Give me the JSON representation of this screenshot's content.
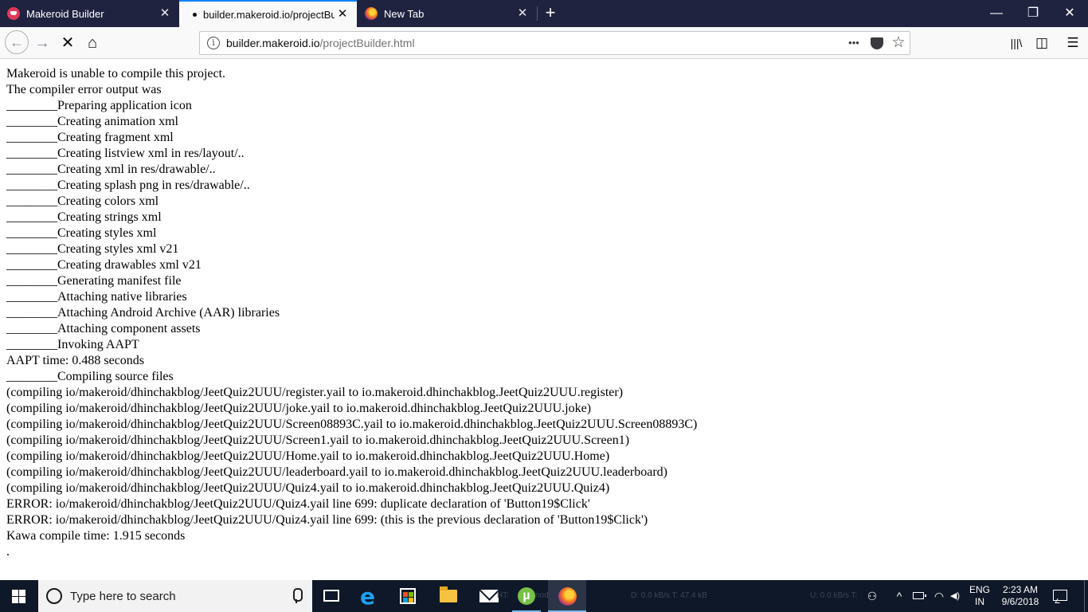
{
  "browser": {
    "tabs": [
      {
        "title": "Makeroid Builder",
        "favicon": "makeroid-icon",
        "active": false
      },
      {
        "title": "builder.makeroid.io/projectBuilder.html",
        "favicon": "loading-dot",
        "active": true
      },
      {
        "title": "New Tab",
        "favicon": "firefox-icon",
        "active": false
      }
    ],
    "close_glyph": "✕",
    "new_tab_glyph": "+",
    "window_controls": {
      "minimize": "—",
      "restore": "❐",
      "close": "✕"
    },
    "nav": {
      "back": "←",
      "forward": "→",
      "stop": "✕",
      "home": "⌂"
    },
    "url": {
      "host": "builder.makeroid.io",
      "path": "/projectBuilder.html"
    },
    "url_actions": {
      "more": "•••",
      "bookmark": "☆"
    },
    "toolbar_right": {
      "library": "|||\\",
      "sidebar": "◫",
      "menu": "☰"
    }
  },
  "page": {
    "lines": [
      "Makeroid is unable to compile this project.",
      "The compiler error output was",
      "________Preparing application icon",
      "________Creating animation xml",
      "________Creating fragment xml",
      "________Creating listview xml in res/layout/..",
      "________Creating xml in res/drawable/..",
      "________Creating splash png in res/drawable/..",
      "________Creating colors xml",
      "________Creating strings xml",
      "________Creating styles xml",
      "________Creating styles xml v21",
      "________Creating drawables xml v21",
      "________Generating manifest file",
      "________Attaching native libraries",
      "________Attaching Android Archive (AAR) libraries",
      "________Attaching component assets",
      "________Invoking AAPT",
      "AAPT time: 0.488 seconds",
      "________Compiling source files",
      "(compiling io/makeroid/dhinchakblog/JeetQuiz2UUU/register.yail to io.makeroid.dhinchakblog.JeetQuiz2UUU.register)",
      "(compiling io/makeroid/dhinchakblog/JeetQuiz2UUU/joke.yail to io.makeroid.dhinchakblog.JeetQuiz2UUU.joke)",
      "(compiling io/makeroid/dhinchakblog/JeetQuiz2UUU/Screen08893C.yail to io.makeroid.dhinchakblog.JeetQuiz2UUU.Screen08893C)",
      "(compiling io/makeroid/dhinchakblog/JeetQuiz2UUU/Screen1.yail to io.makeroid.dhinchakblog.JeetQuiz2UUU.Screen1)",
      "(compiling io/makeroid/dhinchakblog/JeetQuiz2UUU/Home.yail to io.makeroid.dhinchakblog.JeetQuiz2UUU.Home)",
      "(compiling io/makeroid/dhinchakblog/JeetQuiz2UUU/leaderboard.yail to io.makeroid.dhinchakblog.JeetQuiz2UUU.leaderboard)",
      "(compiling io/makeroid/dhinchakblog/JeetQuiz2UUU/Quiz4.yail to io.makeroid.dhinchakblog.JeetQuiz2UUU.Quiz4)",
      "ERROR: io/makeroid/dhinchakblog/JeetQuiz2UUU/Quiz4.yail line 699: duplicate declaration of 'Button19$Click'",
      "ERROR: io/makeroid/dhinchakblog/JeetQuiz2UUU/Quiz4.yail line 699: (this is the previous declaration of 'Button19$Click')",
      "Kawa compile time: 1.915 seconds",
      "."
    ]
  },
  "taskbar": {
    "search_placeholder": "Type here to search",
    "overlay_fragments": {
      "t_label": "HT:",
      "nodes": "nodes",
      "download": "D: 0.0 kB/s T: 47.4 kB",
      "upload": "U: 0.0 kB/s T:"
    },
    "tray": {
      "people": "⚇",
      "chevron": "^",
      "wifi": "◠",
      "volume": "◀)"
    },
    "language": {
      "code": "ENG",
      "region": "IN"
    },
    "clock": {
      "time": "2:23 AM",
      "date": "9/6/2018"
    },
    "colors": {
      "accent": "#76b9ed",
      "taskbar_bg": "#0f1828",
      "tab_accent": "#0a84ff"
    }
  }
}
